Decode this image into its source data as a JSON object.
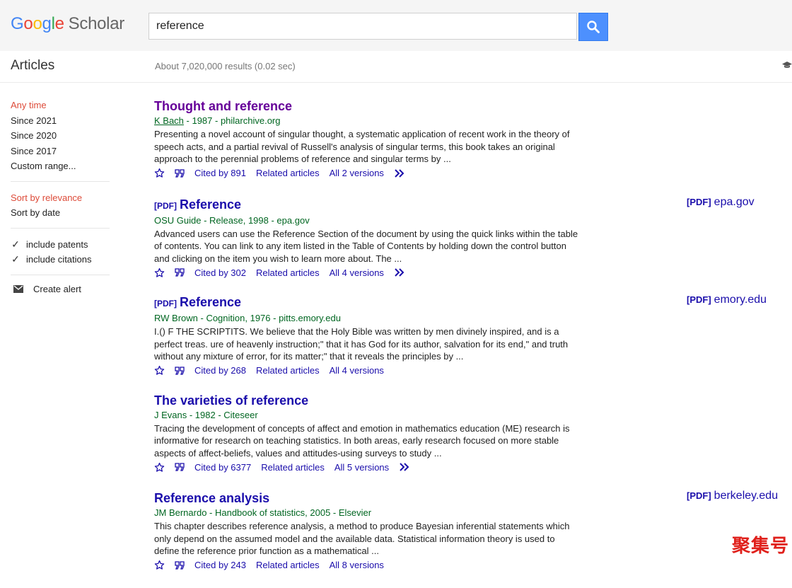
{
  "header": {
    "logo_google": [
      "G",
      "o",
      "o",
      "g",
      "l",
      "e"
    ],
    "logo_scholar": "Scholar",
    "search_value": "reference"
  },
  "subbar": {
    "section_title": "Articles",
    "stats": "About 7,020,000 results (0.02 sec)"
  },
  "sidebar": {
    "time_filters": [
      "Any time",
      "Since 2021",
      "Since 2020",
      "Since 2017",
      "Custom range..."
    ],
    "sort_options": [
      "Sort by relevance",
      "Sort by date"
    ],
    "checkboxes": [
      "include patents",
      "include citations"
    ],
    "create_alert": "Create alert"
  },
  "results": [
    {
      "pdf": "",
      "title_prefix": "Thought and ",
      "title_bold": "reference",
      "byline": "K Bach",
      "byline_rest": " - 1987 - philarchive.org",
      "snippet": "Presenting a novel account of singular thought, a systematic application of recent work in the theory of speech acts, and a partial revival of Russell's analysis of singular terms, this book takes an original approach to the perennial problems of reference and singular terms by ...",
      "cited": "Cited by 891",
      "related": "Related articles",
      "versions": "All 2 versions",
      "side_pdf": "",
      "side_domain": ""
    },
    {
      "pdf": "[PDF]",
      "title_prefix": "",
      "title_bold": "Reference",
      "byline": "OSU Guide",
      "byline_rest": " - Release, 1998 - epa.gov",
      "snippet": "Advanced users can use the Reference Section of the document by using the quick links within the table of contents. You can link to any item listed in the Table of Contents by holding down the control button and clicking on the item you wish to learn more about. The ...",
      "cited": "Cited by 302",
      "related": "Related articles",
      "versions": "All 4 versions",
      "side_pdf": "[PDF]",
      "side_domain": "epa.gov"
    },
    {
      "pdf": "[PDF]",
      "title_prefix": "",
      "title_bold": "Reference",
      "byline": "RW Brown",
      "byline_rest": " - Cognition, 1976 - pitts.emory.edu",
      "snippet": "I.() F THE SCRIPTITS. We believe that the Holy Bible was written by men divinely inspired, and is a perfect treas. ure of heavenly instruction;\" that it has God for its author, salvation for its end,\" and truth without any mixture of error, for its matter;\" that it reveals the principles by ...",
      "cited": "Cited by 268",
      "related": "Related articles",
      "versions": "All 4 versions",
      "side_pdf": "[PDF]",
      "side_domain": "emory.edu"
    },
    {
      "pdf": "",
      "title_prefix": "The varieties of ",
      "title_bold": "reference",
      "byline": "J Evans",
      "byline_rest": " - 1982 - Citeseer",
      "snippet": "Tracing the development of concepts of affect and emotion in mathematics education (ME) research is informative for research on teaching statistics. In both areas, early research focused on more stable aspects of affect-beliefs, values and attitudes-using surveys to study ...",
      "cited": "Cited by 6377",
      "related": "Related articles",
      "versions": "All 5 versions",
      "side_pdf": "",
      "side_domain": ""
    },
    {
      "pdf": "",
      "title_prefix": "",
      "title_bold": "Reference analysis",
      "byline": "JM Bernardo",
      "byline_rest": " - Handbook of statistics, 2005 - Elsevier",
      "snippet": "This chapter describes reference analysis, a method to produce Bayesian inferential statements which only depend on the assumed model and the available data. Statistical information theory is used to define the reference prior function as a mathematical ...",
      "cited": "Cited by 243",
      "related": "Related articles",
      "versions": "All 8 versions",
      "side_pdf": "[PDF]",
      "side_domain": "berkeley.edu"
    }
  ],
  "watermark": "聚集号",
  "colors": {
    "link": "#1a0dab",
    "visited": "#660099",
    "byline": "#006621",
    "selected": "#dd4b39",
    "search_button": "#4d90fe"
  }
}
